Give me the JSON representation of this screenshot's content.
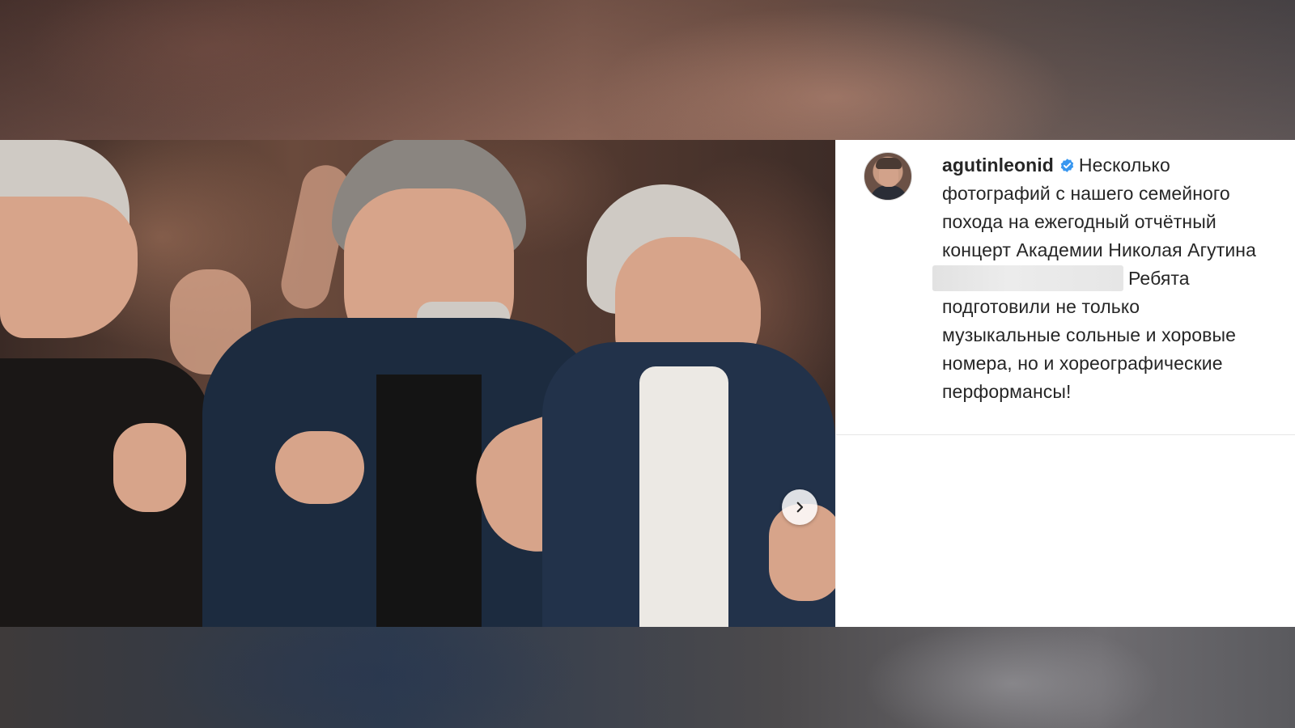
{
  "post": {
    "username": "agutinleonid",
    "verified": true,
    "caption_lines": [
      "Несколько",
      "фотографий с нашего семейного",
      "похода на ежегодный отчётный",
      "концерт Академии Николая Агутина",
      "Ребята",
      "подготовили не только",
      "музыкальные сольные и хоровые",
      "номера, но и хореографические",
      "перформансы!"
    ]
  },
  "carousel": {
    "next_icon": "chevron-right-icon"
  },
  "colors": {
    "verified_badge": "#3897f0",
    "text": "#262626",
    "background": "#ffffff"
  }
}
